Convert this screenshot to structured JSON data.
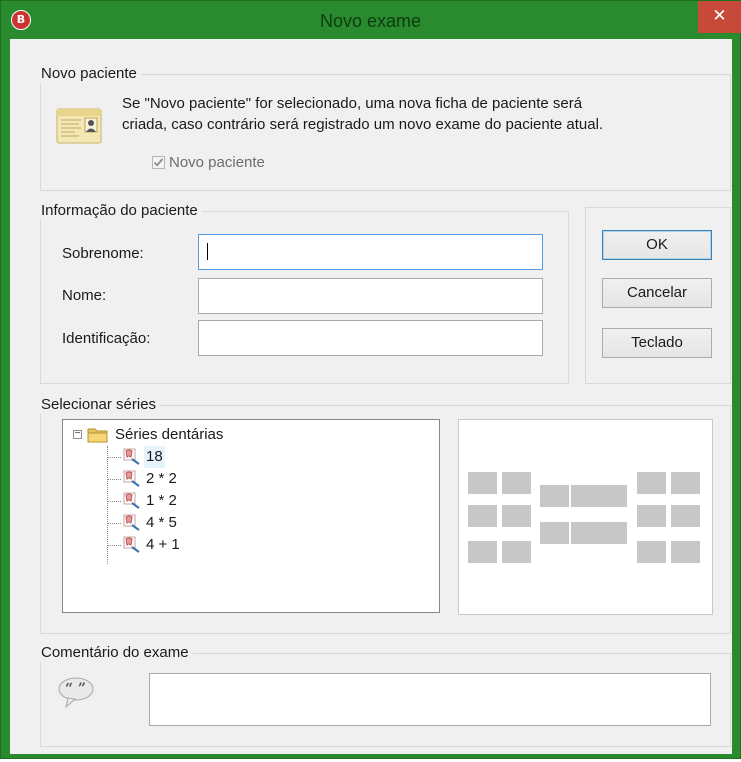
{
  "window": {
    "title": "Novo exame",
    "close_glyph": "✕",
    "app_icon_glyph": "B"
  },
  "new_patient": {
    "legend": "Novo paciente",
    "description_line1": "Se \"Novo paciente\" for selecionado, uma nova ficha de paciente será",
    "description_line2": "criada, caso contrário será registrado um novo exame do paciente atual.",
    "checkbox_label": "Novo paciente",
    "checkbox_checked": true,
    "checkbox_enabled": false
  },
  "patient_info": {
    "legend": "Informação do paciente",
    "surname_label": "Sobrenome:",
    "surname_value": "",
    "name_label": "Nome:",
    "name_value": "",
    "id_label": "Identificação:",
    "id_value": ""
  },
  "buttons": {
    "ok": "OK",
    "cancel": "Cancelar",
    "keyboard": "Teclado"
  },
  "series": {
    "legend": "Selecionar séries",
    "root": {
      "label": "Séries dentárias",
      "expanded": true,
      "expander": "−"
    },
    "items": [
      {
        "label": "18",
        "selected": true
      },
      {
        "label": "2 * 2",
        "selected": false
      },
      {
        "label": "1 * 2",
        "selected": false
      },
      {
        "label": "4 * 5",
        "selected": false
      },
      {
        "label": "4 + 1",
        "selected": false
      }
    ]
  },
  "comment": {
    "legend": "Comentário do exame",
    "value": ""
  },
  "icons": {
    "patient_card": "id-card-icon",
    "folder": "folder-icon",
    "tooth_series": "tooth-series-icon",
    "comment": "speech-bubble-quote-icon"
  },
  "colors": {
    "title_bar": "#2a8a2e",
    "close_button": "#c7493a",
    "dialog_bg": "#f0f0f0",
    "preview_tile": "#c7c7c7"
  }
}
